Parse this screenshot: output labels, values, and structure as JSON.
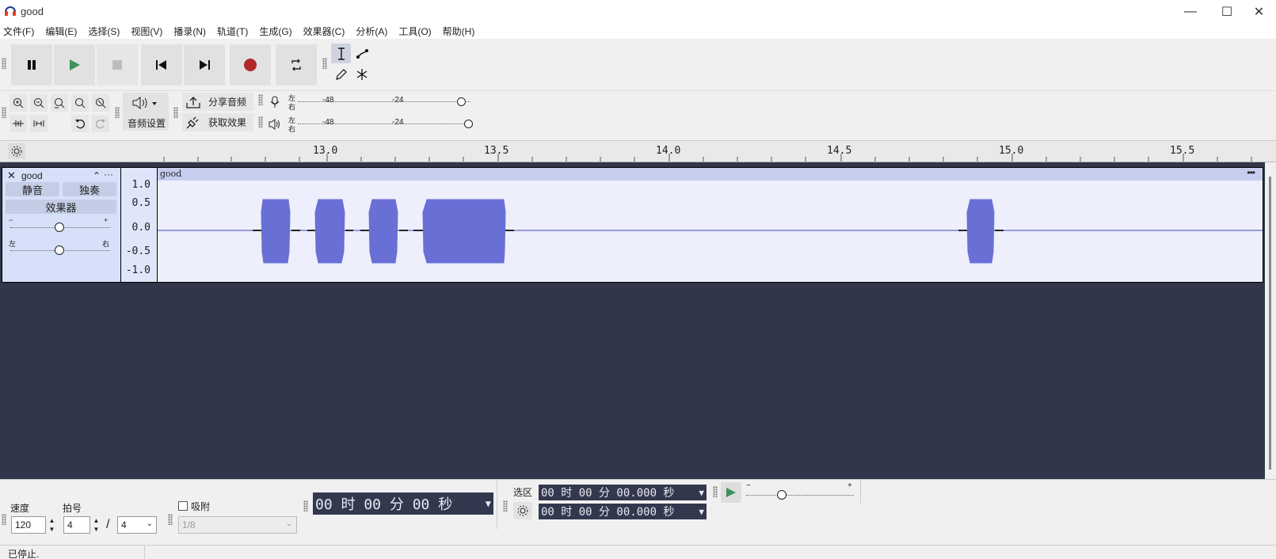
{
  "window": {
    "title": "good",
    "minimize": "—",
    "maximize": "☐",
    "close": "✕"
  },
  "menu": [
    "文件(F)",
    "编辑(E)",
    "选择(S)",
    "视图(V)",
    "播录(N)",
    "轨道(T)",
    "生成(G)",
    "效果器(C)",
    "分析(A)",
    "工具(O)",
    "帮助(H)"
  ],
  "toolbar": {
    "audio_setup_label": "音频设置",
    "share_label": "分享音频",
    "get_effects_label": "获取效果",
    "meter_left": "左",
    "meter_right": "右",
    "record_meter_ticks": [
      "-48",
      "-24"
    ],
    "play_meter_ticks": [
      "-48",
      "-24"
    ]
  },
  "ruler": {
    "ticks": [
      "13.0",
      "13.5",
      "14.0",
      "14.5",
      "15.0",
      "15.5"
    ]
  },
  "track": {
    "name": "good",
    "collapse": "⌃",
    "menu": "···",
    "mute_label": "静音",
    "solo_label": "独奏",
    "effects_label": "效果器",
    "gain_minus": "−",
    "gain_plus": "+",
    "pan_left": "左",
    "pan_right": "右",
    "clip_name": "good",
    "clip_menu": "•••",
    "scale": [
      "1.0",
      "0.5",
      "0.0",
      "-0.5",
      "-1.0"
    ]
  },
  "bottom": {
    "tempo_label": "速度",
    "tempo_value": "120",
    "meter_label": "拍号",
    "beats_value": "4",
    "slash": "/",
    "beat_unit": "4",
    "snap_label": "吸附",
    "snap_value": "1/8",
    "time_display": "00 时 00 分 00 秒",
    "selection_label": "选区",
    "sel_start": "00 时 00 分 00.000 秒",
    "sel_end": "00 时 00 分 00.000 秒",
    "speed_minus": "−",
    "speed_plus": "+"
  },
  "status": {
    "text": "已停止."
  },
  "colors": {
    "waveform": "#6a6fd6",
    "track_bg": "#32364a",
    "record": "#b02a2a",
    "play": "#3f8f5f"
  }
}
